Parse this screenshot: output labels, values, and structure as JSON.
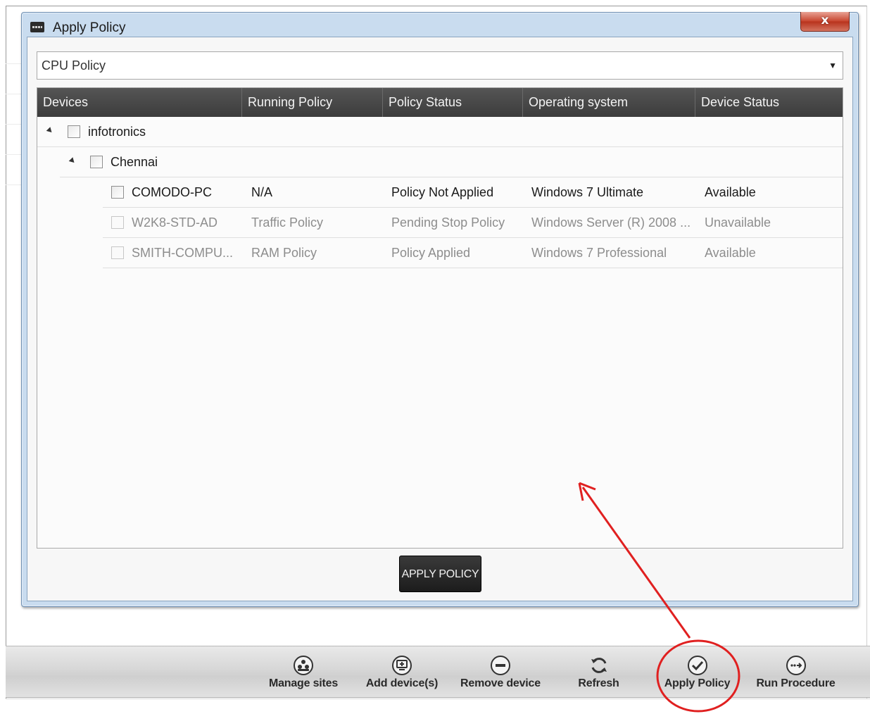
{
  "dialog": {
    "title": "Apply Policy",
    "close_label": "x",
    "policy_select_value": "CPU Policy",
    "apply_button_label": "APPLY POLICY"
  },
  "grid": {
    "columns": [
      "Devices",
      "Running Policy",
      "Policy Status",
      "Operating system",
      "Device Status"
    ],
    "groups": [
      {
        "name": "infotronics"
      },
      {
        "name": "Chennai"
      }
    ],
    "rows": [
      {
        "device": "COMODO-PC",
        "running_policy": "N/A",
        "policy_status": "Policy Not Applied",
        "os": "Windows 7 Ultimate",
        "device_status": "Available",
        "dimmed": false
      },
      {
        "device": "W2K8-STD-AD",
        "running_policy": "Traffic Policy",
        "policy_status": "Pending Stop Policy",
        "os": "Windows Server (R) 2008 ...",
        "device_status": "Unavailable",
        "dimmed": true
      },
      {
        "device": "SMITH-COMPU...",
        "running_policy": "RAM Policy",
        "policy_status": "Policy Applied",
        "os": "Windows 7 Professional",
        "device_status": "Available",
        "dimmed": true
      }
    ]
  },
  "toolbar": {
    "buttons": [
      {
        "label": "Manage sites",
        "icon": "manage-sites-icon"
      },
      {
        "label": "Add device(s)",
        "icon": "add-device-icon"
      },
      {
        "label": "Remove device",
        "icon": "remove-device-icon"
      },
      {
        "label": "Refresh",
        "icon": "refresh-icon"
      },
      {
        "label": "Apply Policy",
        "icon": "checkmark-icon"
      },
      {
        "label": "Run Procedure",
        "icon": "run-procedure-icon"
      }
    ]
  },
  "annotation": {
    "color": "#e02020"
  }
}
